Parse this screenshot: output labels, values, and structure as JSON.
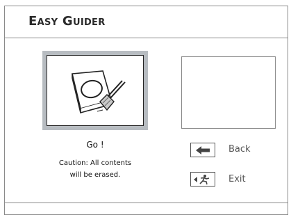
{
  "header": {
    "title": "Easy Guider"
  },
  "main": {
    "go_label": "Go !",
    "caution_line1": "Caution: All contents",
    "caution_line2": "will be erased.",
    "thumbnail_icon": "disc-erase-icon"
  },
  "nav": {
    "back_label": "Back",
    "back_icon": "back-arrow-icon",
    "exit_label": "Exit",
    "exit_icon": "exit-running-man-icon"
  },
  "colors": {
    "border": "#8a8a8a",
    "thumbnail_highlight": "#b7bcc1",
    "label_gray": "#555555"
  }
}
